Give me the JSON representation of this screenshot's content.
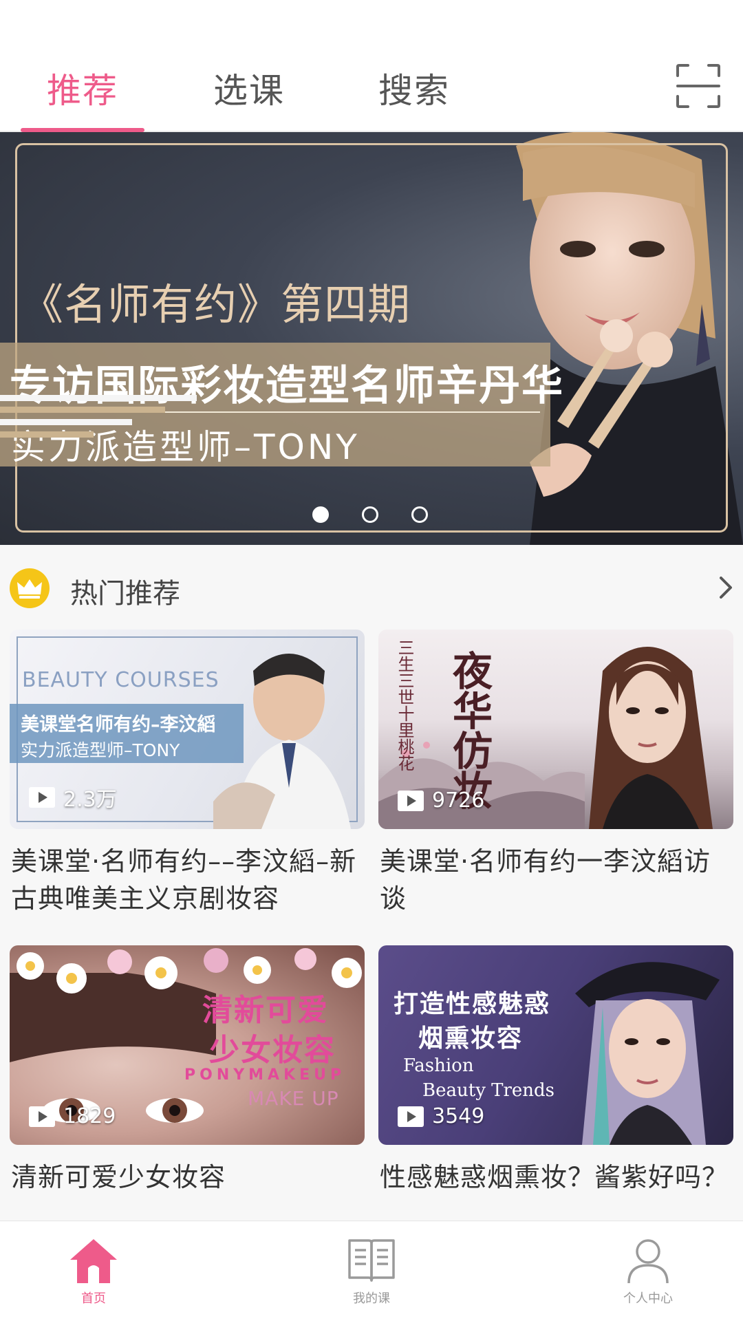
{
  "colors": {
    "accent": "#ee5b8a",
    "text": "#333333",
    "muted": "#999999",
    "gold": "#f5c518"
  },
  "top_tabs": [
    {
      "label": "推荐",
      "active": true
    },
    {
      "label": "选课",
      "active": false
    },
    {
      "label": "搜索",
      "active": false
    }
  ],
  "icons": {
    "scan": "scan-icon",
    "crown": "crown-icon",
    "more": "chevron-right-icon",
    "play": "play-icon"
  },
  "banner": {
    "title": "《名师有约》第四期",
    "headline": "专访国际彩妆造型名师辛丹华",
    "subtitle": "实力派造型师–TONY",
    "pagination": {
      "count": 3,
      "active_index": 0
    }
  },
  "section": {
    "title": "热门推荐"
  },
  "cards": [
    {
      "thumb_text": {
        "word": "BEAUTY  COURSES",
        "line1": "美课堂名师有约–李汶縚",
        "line2": "实力派造型师–TONY"
      },
      "plays": "2.3万",
      "title": "美课堂·名师有约––李汶縚–新古典唯美主义京剧妆容"
    },
    {
      "thumb_text": {
        "small": "三生三世十里桃花",
        "calligraphy": "夜华仿妆"
      },
      "plays": "9726",
      "title": "美课堂·名师有约一李汶縚访谈"
    },
    {
      "thumb_text": {
        "line1": "清新可爱",
        "line2": "少女妆容",
        "line3": "PONYMAKEUP",
        "line4": "MAKE UP"
      },
      "plays": "1829",
      "title": "清新可爱少女妆容"
    },
    {
      "thumb_text": {
        "line1": "打造性感魅惑",
        "line2": "烟熏妆容",
        "line3": "Fashion",
        "line4": "Beauty Trends"
      },
      "plays": "3549",
      "title": "性感魅惑烟熏妆？酱紫好吗？"
    }
  ],
  "bottom_nav": [
    {
      "label": "首页",
      "icon": "home-icon",
      "active": true
    },
    {
      "label": "我的课",
      "icon": "book-icon",
      "active": false
    },
    {
      "label": "个人中心",
      "icon": "person-icon",
      "active": false
    }
  ]
}
